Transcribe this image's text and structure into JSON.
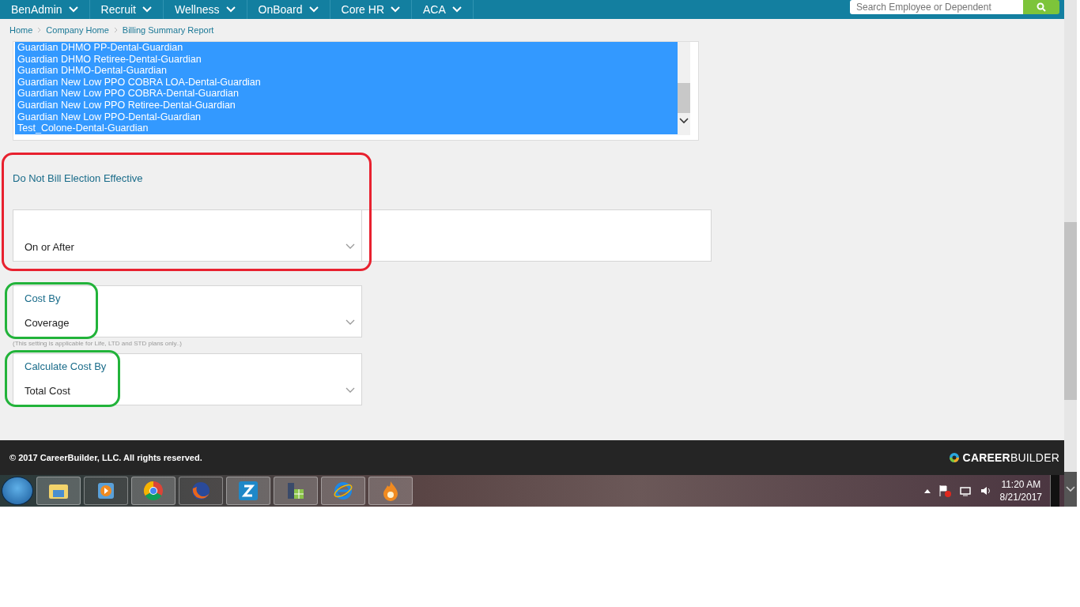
{
  "nav": {
    "items": [
      {
        "label": "BenAdmin"
      },
      {
        "label": "Recruit"
      },
      {
        "label": "Wellness"
      },
      {
        "label": "OnBoard"
      },
      {
        "label": "Core HR"
      },
      {
        "label": "ACA"
      }
    ],
    "search": {
      "placeholder": "Search Employee or Dependent"
    }
  },
  "breadcrumb": [
    "Home",
    "Company Home",
    "Billing Summary Report"
  ],
  "plan_list": {
    "items": [
      {
        "label": "Guardian DHMO PP-Dental-Guardian",
        "selected": true
      },
      {
        "label": "Guardian DHMO Retiree-Dental-Guardian",
        "selected": true
      },
      {
        "label": "Guardian DHMO-Dental-Guardian",
        "selected": true
      },
      {
        "label": "Guardian New Low PPO COBRA LOA-Dental-Guardian",
        "selected": true
      },
      {
        "label": "Guardian New Low PPO COBRA-Dental-Guardian",
        "selected": true
      },
      {
        "label": "Guardian New Low PPO Retiree-Dental-Guardian",
        "selected": true
      },
      {
        "label": "Guardian New Low PPO-Dental-Guardian",
        "selected": true
      },
      {
        "label": "Test_Colone-Dental-Guardian",
        "selected": true
      }
    ]
  },
  "fields": [
    {
      "kind": "date-rule",
      "label": "Do Not Bill Election Effective",
      "value": "On or After",
      "color": "#e8212f"
    },
    {
      "kind": "select",
      "label": "Cost By",
      "value": "Coverage",
      "note": "(This setting is applicable for Life, LTD and STD plans only..)",
      "color": "#22b33a"
    },
    {
      "kind": "select",
      "label": "Calculate Cost By",
      "value": "Total Cost",
      "color": "#22b33a"
    }
  ],
  "footer": {
    "copyright": "© 2017 CareerBuilder, LLC. All rights reserved.",
    "logo": "**CAREER**BUILDER"
  },
  "taskbar": {
    "time": "11:20 AM",
    "date": "8/21/2017"
  }
}
